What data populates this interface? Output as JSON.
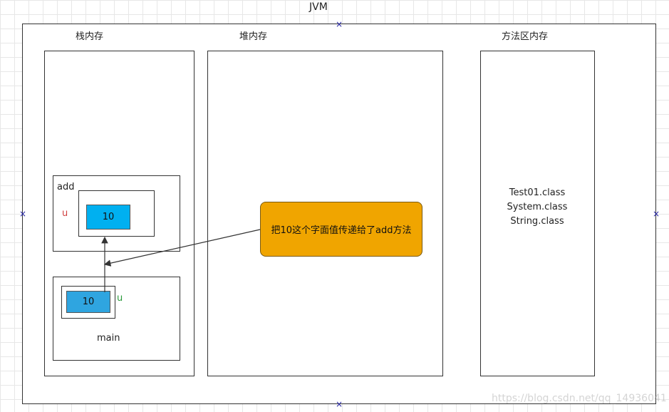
{
  "jvm": {
    "title": "JVM",
    "stack": {
      "title": "栈内存",
      "add_frame": {
        "label": "add",
        "var_name": "u",
        "value": "10"
      },
      "main_frame": {
        "label": "main",
        "var_name": "u",
        "value": "10"
      }
    },
    "heap": {
      "title": "堆内存"
    },
    "method_area": {
      "title": "方法区内存",
      "classes": [
        "Test01.class",
        "System.class",
        "String.class"
      ]
    },
    "note": "把10这个字面值传递给了add方法"
  },
  "colors": {
    "add_value_fill": "#00b0f0",
    "main_value_fill": "#2fa5e0",
    "note_fill": "#f0a500",
    "add_var_color": "#d04040",
    "main_var_color": "#2a9a3a",
    "handle_color": "#1f1fa0"
  },
  "icons": {
    "handle": "x-mark-icon",
    "arrow": "arrow-icon"
  },
  "watermark": "https://blog.csdn.net/qq_14936041"
}
